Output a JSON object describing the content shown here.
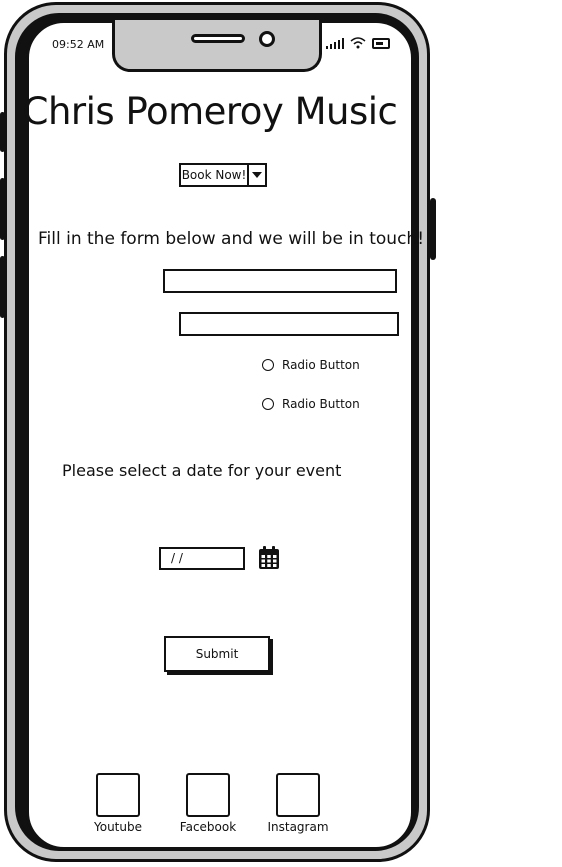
{
  "status_bar": {
    "time": "09:52 AM"
  },
  "header": {
    "title": "Chris Pomeroy Music"
  },
  "booking": {
    "button_label": "Book Now!"
  },
  "form": {
    "instructions": "Fill in the form below and we will be in touch!",
    "radio_options": [
      {
        "label": "Radio Button"
      },
      {
        "label": "Radio Button"
      }
    ],
    "date_prompt": "Please select a date for your event",
    "date_value": "/ /",
    "submit_label": "Submit"
  },
  "social_links": [
    {
      "label": "Youtube"
    },
    {
      "label": "Facebook"
    },
    {
      "label": "Instagram"
    }
  ]
}
